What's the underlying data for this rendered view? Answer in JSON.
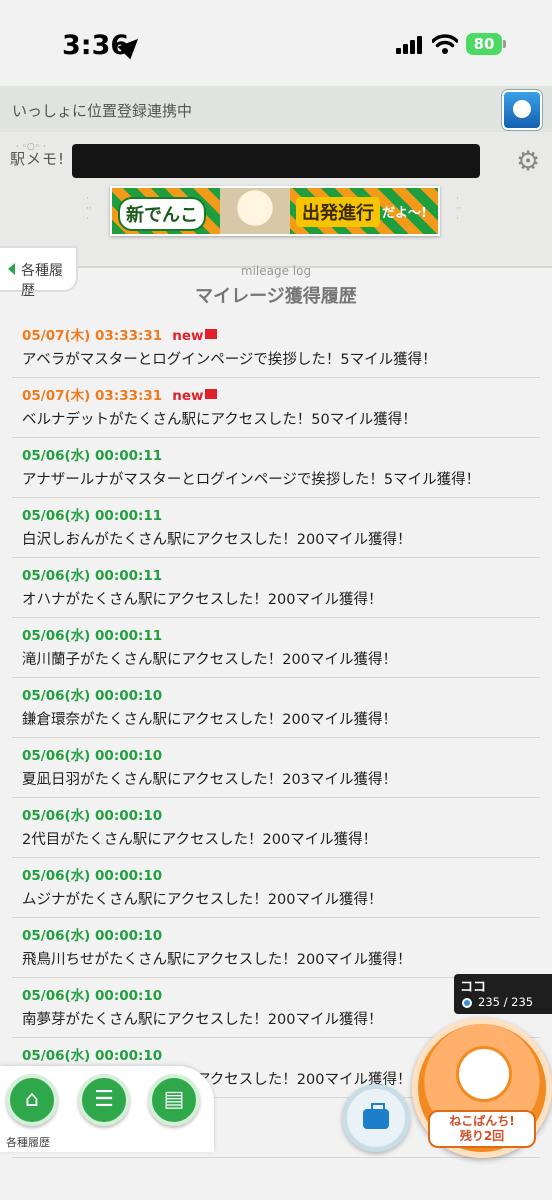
{
  "status_bar": {
    "time": "3:36",
    "battery": "80"
  },
  "header": {
    "location_status": "いっしょに位置登録連携中",
    "logo": "駅メモ!",
    "banner": {
      "left_text": "新でんこ",
      "right_text": "出発進行",
      "tail_text": "だよ〜!"
    }
  },
  "page": {
    "back_label": "各種履歴",
    "title_en": "mileage log",
    "title_jp": "マイレージ獲得履歴"
  },
  "log": [
    {
      "time": "05/07(木) 03:33:31",
      "new": "new",
      "text": "アベラがマスターとログインページで挨拶した！5マイル獲得！"
    },
    {
      "time": "05/07(木) 03:33:31",
      "new": "new",
      "text": "ベルナデットがたくさん駅にアクセスした！50マイル獲得！"
    },
    {
      "time": "05/06(水) 00:00:11",
      "new": "",
      "text": "アナザールナがマスターとログインページで挨拶した！5マイル獲得！"
    },
    {
      "time": "05/06(水) 00:00:11",
      "new": "",
      "text": "白沢しおんがたくさん駅にアクセスした！200マイル獲得！"
    },
    {
      "time": "05/06(水) 00:00:11",
      "new": "",
      "text": "オハナがたくさん駅にアクセスした！200マイル獲得！"
    },
    {
      "time": "05/06(水) 00:00:11",
      "new": "",
      "text": "滝川蘭子がたくさん駅にアクセスした！200マイル獲得！"
    },
    {
      "time": "05/06(水) 00:00:10",
      "new": "",
      "text": "鎌倉環奈がたくさん駅にアクセスした！200マイル獲得！"
    },
    {
      "time": "05/06(水) 00:00:10",
      "new": "",
      "text": "夏凪日羽がたくさん駅にアクセスした！203マイル獲得！"
    },
    {
      "time": "05/06(水) 00:00:10",
      "new": "",
      "text": "2代目がたくさん駅にアクセスした！200マイル獲得！"
    },
    {
      "time": "05/06(水) 00:00:10",
      "new": "",
      "text": "ムジナがたくさん駅にアクセスした！200マイル獲得！"
    },
    {
      "time": "05/06(水) 00:00:10",
      "new": "",
      "text": "飛鳥川ちせがたくさん駅にアクセスした！200マイル獲得！"
    },
    {
      "time": "05/06(水) 00:00:10",
      "new": "",
      "text": "南夢芽がたくさん駅にアクセスした！200マイル獲得！"
    },
    {
      "time": "05/06(水) 00:00:10",
      "new": "",
      "text": "新条アカネがたくさん駅にアクセスした！200マイル獲得！"
    },
    {
      "time": "",
      "new": "",
      "text": "にアクセスした！20"
    }
  ],
  "bottom_nav": {
    "label": "各種履歴"
  },
  "coco": {
    "title": "ココ",
    "value": "235 / 235"
  },
  "neko": {
    "label_line1": "ねこぱんち!",
    "label_line2": "残り2回"
  },
  "colors": {
    "accent_green": "#22a040",
    "new_orange": "#f07a1e",
    "new_red": "#e0202a"
  }
}
